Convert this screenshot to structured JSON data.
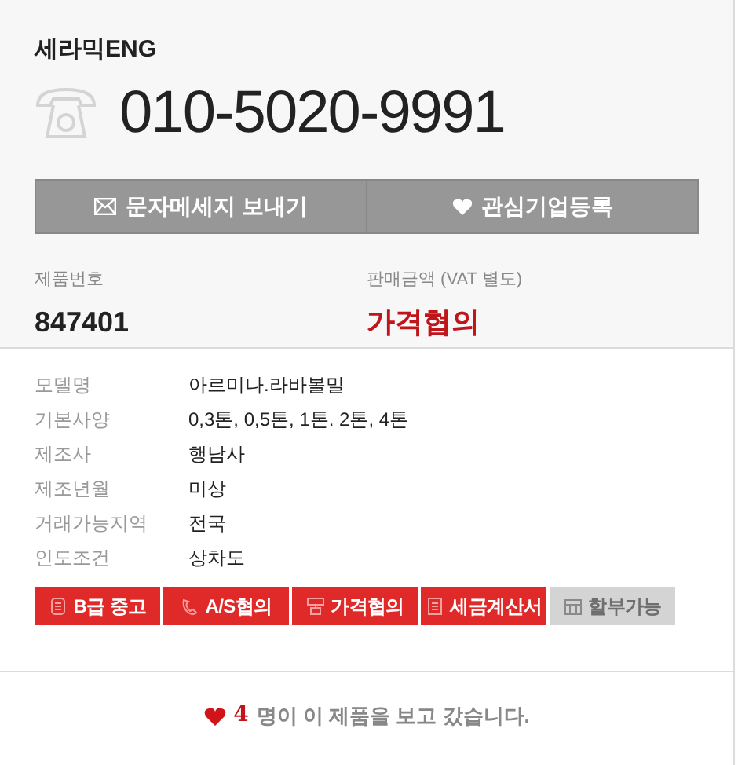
{
  "seller": {
    "name": "세라믹ENG",
    "phone": "010-5020-9991"
  },
  "actions": [
    {
      "kind": "message",
      "label": "문자메세지 보내기"
    },
    {
      "kind": "favorite",
      "label": "관심기업등록"
    }
  ],
  "summary": [
    {
      "label": "제품번호",
      "value": "847401",
      "kind": "plain"
    },
    {
      "label": "판매금액 (VAT 별도)",
      "value": "가격협의",
      "kind": "price"
    }
  ],
  "specs": [
    {
      "label": "모델명",
      "value": "아르미나.라바볼밀"
    },
    {
      "label": "기본사양",
      "value": "0,3톤, 0,5톤, 1톤. 2톤, 4톤"
    },
    {
      "label": "제조사",
      "value": "행남사"
    },
    {
      "label": "제조년월",
      "value": "미상"
    },
    {
      "label": "거래가능지역",
      "value": "전국"
    },
    {
      "label": "인도조건",
      "value": "상차도"
    }
  ],
  "badges": [
    {
      "kind": "grade",
      "label": "B급 중고",
      "disabled": false
    },
    {
      "kind": "service",
      "label": "A/S협의",
      "disabled": false
    },
    {
      "kind": "price",
      "label": "가격협의",
      "disabled": false
    },
    {
      "kind": "invoice",
      "label": "세금계산서",
      "disabled": false
    },
    {
      "kind": "installment",
      "label": "할부가능",
      "disabled": true
    }
  ],
  "views": {
    "count": "4",
    "text": "명이 이 제품을 보고 갔습니다."
  }
}
